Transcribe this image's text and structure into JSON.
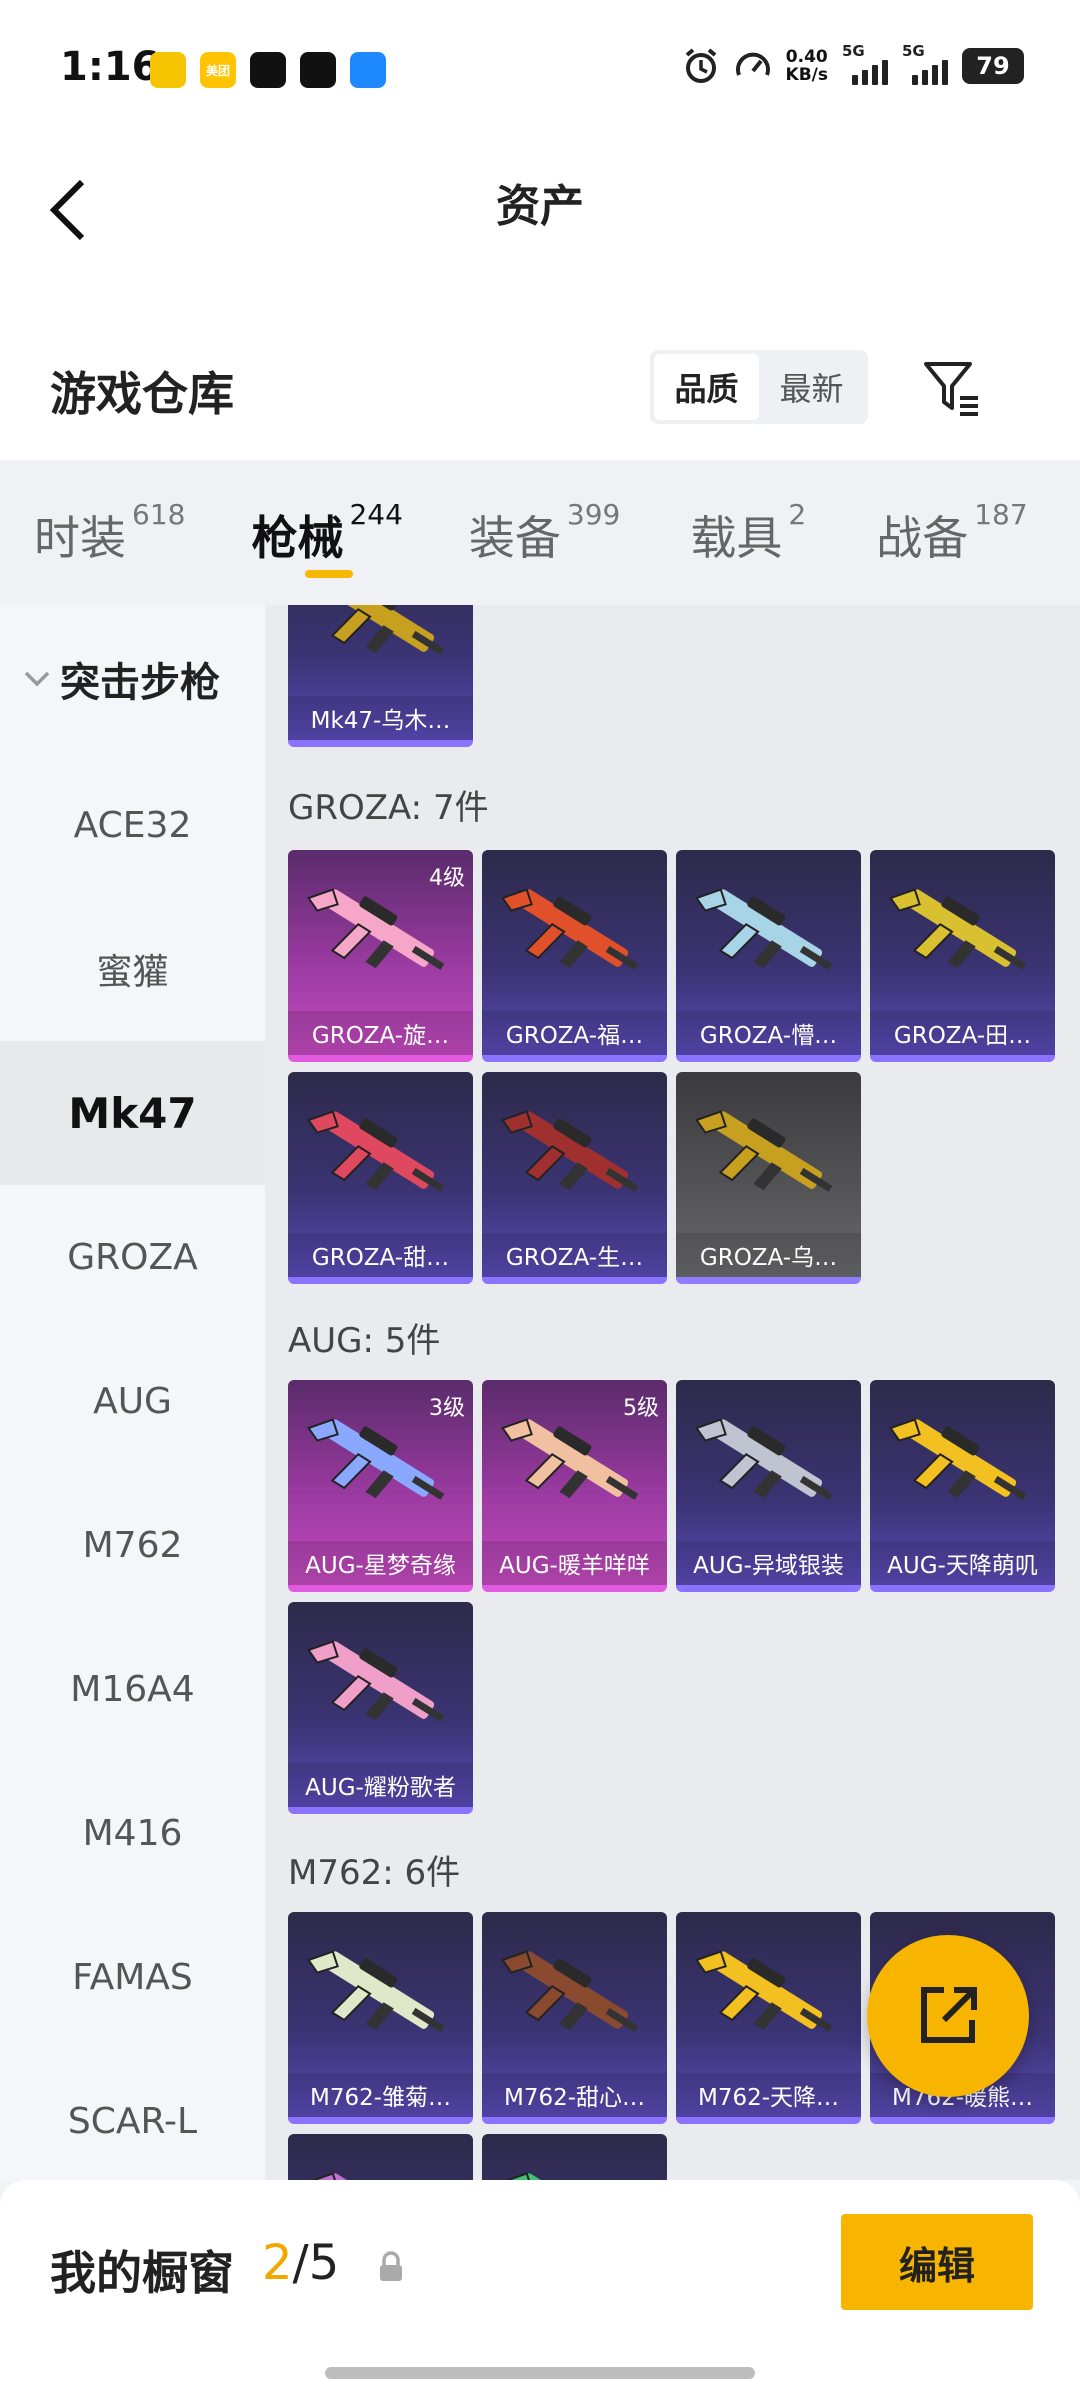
{
  "status_bar": {
    "time": "1:16",
    "app_icons": [
      {
        "icon": "bee-app-icon",
        "color": "#f6c400",
        "text": ""
      },
      {
        "icon": "meituan-icon",
        "color": "#ffc300",
        "text": "美团"
      },
      {
        "icon": "tiktok-icon",
        "color": "#111111",
        "text": ""
      },
      {
        "icon": "capcut-icon",
        "color": "#111111",
        "text": ""
      },
      {
        "icon": "feather-app-icon",
        "color": "#1e88ff",
        "text": ""
      }
    ],
    "net_speed_value": "0.40",
    "net_speed_unit": "KB/s",
    "sim1": "5G",
    "sim2": "5G",
    "battery": "79"
  },
  "header": {
    "title": "资产"
  },
  "warehouse": {
    "title": "游戏仓库",
    "sort_options": [
      "品质",
      "最新"
    ],
    "active_sort": "品质"
  },
  "tabs": [
    {
      "label": "时装",
      "count": "618"
    },
    {
      "label": "枪械",
      "count": "244",
      "active": true
    },
    {
      "label": "装备",
      "count": "399"
    },
    {
      "label": "载具",
      "count": "2"
    },
    {
      "label": "战备",
      "count": "187"
    }
  ],
  "sidebar": {
    "group_label": "突击步枪",
    "items": [
      "ACE32",
      "蜜獾",
      "Mk47",
      "GROZA",
      "AUG",
      "M762",
      "M16A4",
      "M416",
      "FAMAS",
      "SCAR-L"
    ],
    "active_item": "Mk47"
  },
  "sections": {
    "top_card": {
      "name": "Mk47-乌木…",
      "style": "purple",
      "gun_color": "#c8a020"
    },
    "groza": {
      "title": "GROZA: 7件",
      "cards": [
        {
          "name": "GROZA-旋…",
          "level": "4级",
          "style": "pink",
          "gun_color": "#f6a6c8"
        },
        {
          "name": "GROZA-福…",
          "level": "",
          "style": "purple",
          "gun_color": "#e0502a"
        },
        {
          "name": "GROZA-懵…",
          "level": "",
          "style": "purple",
          "gun_color": "#a8d4e8"
        },
        {
          "name": "GROZA-田…",
          "level": "",
          "style": "purple",
          "gun_color": "#d8c030"
        },
        {
          "name": "GROZA-甜…",
          "level": "",
          "style": "purple",
          "gun_color": "#e04860"
        },
        {
          "name": "GROZA-生…",
          "level": "",
          "style": "purple",
          "gun_color": "#a03030"
        },
        {
          "name": "GROZA-乌…",
          "level": "",
          "style": "grey",
          "gun_color": "#c8a020"
        }
      ]
    },
    "aug": {
      "title": "AUG: 5件",
      "cards": [
        {
          "name": "AUG-星梦奇缘",
          "level": "3级",
          "style": "pink",
          "gun_color": "#8aa8ff"
        },
        {
          "name": "AUG-暖羊咩咩",
          "level": "5级",
          "style": "pink",
          "gun_color": "#f0c0a0"
        },
        {
          "name": "AUG-异域银装",
          "level": "",
          "style": "purple",
          "gun_color": "#c0c4d0"
        },
        {
          "name": "AUG-天降萌叽",
          "level": "",
          "style": "purple",
          "gun_color": "#f2c020"
        },
        {
          "name": "AUG-耀粉歌者",
          "level": "",
          "style": "purple",
          "gun_color": "#f0a0c8"
        }
      ]
    },
    "m762": {
      "title": "M762: 6件",
      "cards": [
        {
          "name": "M762-雏菊…",
          "level": "",
          "style": "purple",
          "gun_color": "#dfe8c8"
        },
        {
          "name": "M762-甜心…",
          "level": "",
          "style": "purple",
          "gun_color": "#8a4a30"
        },
        {
          "name": "M762-天降…",
          "level": "",
          "style": "purple",
          "gun_color": "#f2c020"
        },
        {
          "name": "M762-暖熊…",
          "level": "",
          "style": "purple",
          "gun_color": "#d8a070"
        },
        {
          "name": "",
          "level": "",
          "style": "purple",
          "gun_color": "#c070d0"
        },
        {
          "name": "",
          "level": "",
          "style": "purple",
          "gun_color": "#40c070"
        }
      ]
    }
  },
  "fab": {
    "icon": "share-external-icon"
  },
  "showcase": {
    "title": "我的橱窗",
    "current": "2",
    "separator": "/",
    "max": "5",
    "lock_icon": "lock-icon",
    "edit_label": "编辑"
  },
  "colors": {
    "accent": "#f8b500",
    "tab_underline": "#f6b800",
    "card_purple_border": "#8c73ff",
    "card_pink_border": "#e25ae0"
  }
}
